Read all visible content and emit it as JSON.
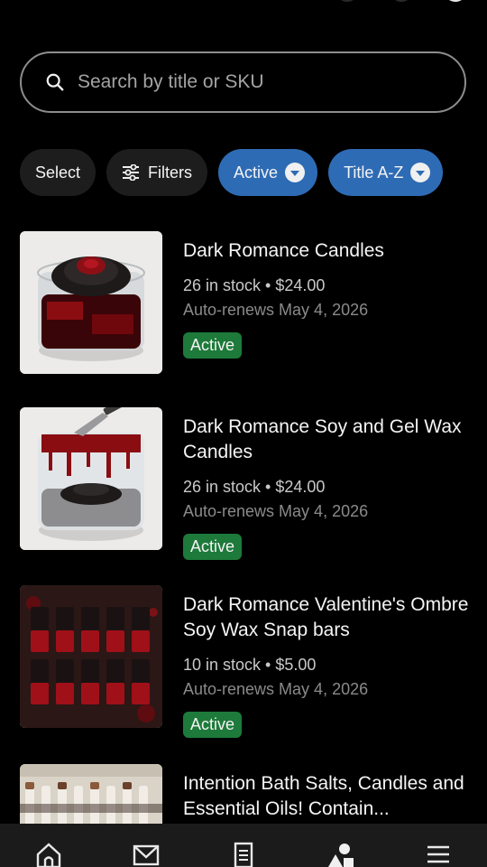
{
  "search": {
    "placeholder": "Search by title or SKU"
  },
  "chips": {
    "select_label": "Select",
    "filters_label": "Filters",
    "status_label": "Active",
    "sort_label": "Title A-Z"
  },
  "colors": {
    "background": "#000000",
    "chip_blue": "#2e6bb5",
    "active_badge": "#1d7a3a",
    "chip_dark": "#1d1d1d"
  },
  "listings": [
    {
      "title": "Dark Romance Candles",
      "stock": "26 in stock • $24.00",
      "renews": "Auto-renews May 4, 2026",
      "status": "Active",
      "image": "candle-rose-jar"
    },
    {
      "title": "Dark Romance Soy and Gel Wax Candles",
      "stock": "26 in stock • $24.00",
      "renews": "Auto-renews May 4, 2026",
      "status": "Active",
      "image": "candle-knife-dripping"
    },
    {
      "title": "Dark Romance Valentine's Ombre Soy Wax Snap bars",
      "stock": "10 in stock • $5.00",
      "renews": "Auto-renews May 4, 2026",
      "status": "Active",
      "image": "snap-bars-grid"
    },
    {
      "title": "Intention Bath Salts, Candles and Essential Oils! Contain...",
      "image": "bath-salt-vials"
    }
  ],
  "bottom_nav": [
    "home-icon",
    "messages-icon",
    "orders-icon",
    "shapes-icon",
    "menu-icon"
  ]
}
